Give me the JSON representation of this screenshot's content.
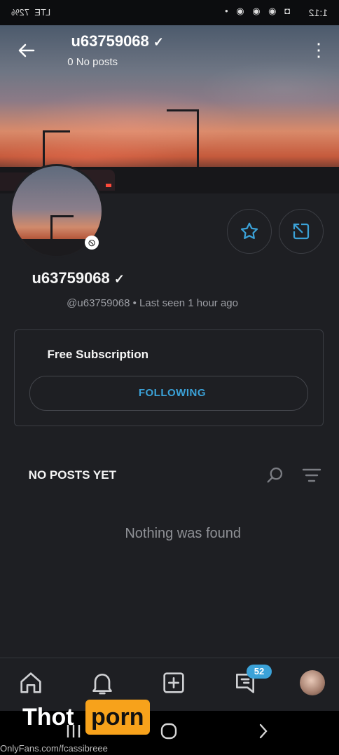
{
  "status_bar": {
    "time": "1:12",
    "icons": "◘ ◉ ◉ ◉ •",
    "signal": "LTE",
    "battery": "72%"
  },
  "header": {
    "username": "u63759068",
    "post_count": "0 No posts"
  },
  "profile": {
    "name": "u63759068",
    "handle_and_seen": "@u63759068  •  Last seen 1 hour ago"
  },
  "subscription": {
    "title": "Free Subscription",
    "button_label": "FOLLOWING"
  },
  "posts": {
    "section_label": "NO POSTS YET",
    "empty_message": "Nothing was found"
  },
  "bottom_nav": {
    "messages_badge": "52"
  },
  "watermark": {
    "brand_left": "Thot",
    "brand_right": "porn",
    "url": "OnlyFans.com/fcassibreee"
  },
  "colors": {
    "accent": "#3ba2d8",
    "background": "#1e1f23"
  }
}
